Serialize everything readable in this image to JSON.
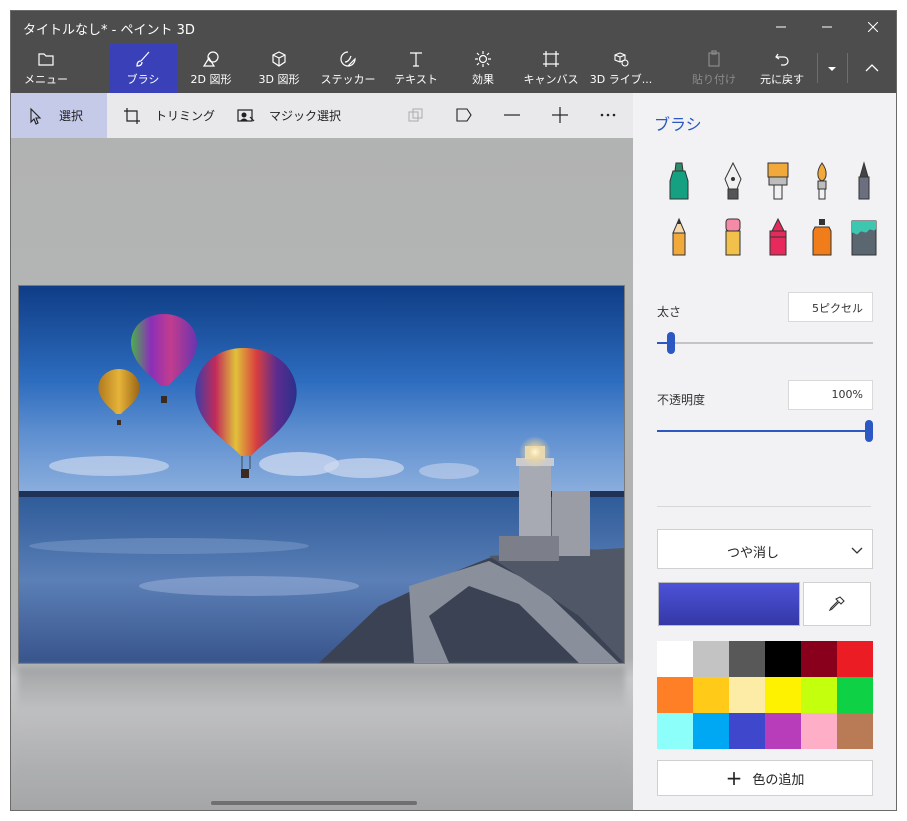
{
  "window": {
    "title": "タイトルなし* - ペイント 3D"
  },
  "titlebar_buttons": [
    "minimize-icon",
    "maximize-icon",
    "close-icon"
  ],
  "toolbar": {
    "menu": "メニュー",
    "brush": "ブラシ",
    "shapes2d": "2D 図形",
    "shapes3d": "3D 図形",
    "stickers": "ステッカー",
    "text": "テキスト",
    "effects": "効果",
    "canvas": "キャンバス",
    "library3d": "3D ライブ...",
    "paste": "貼り付け",
    "undo": "元に戻す"
  },
  "subtoolbar": {
    "select": "選択",
    "crop": "トリミング",
    "magic_select": "マジック選択"
  },
  "panel": {
    "title": "ブラシ",
    "brushes": [
      "marker",
      "calligraphy-pen",
      "oil-brush",
      "watercolor",
      "pixel-pen",
      "pencil",
      "eraser",
      "crayon",
      "spray-can",
      "fill"
    ],
    "thickness_label": "太さ",
    "thickness_value": "5ピクセル",
    "thickness_fraction": 0.05,
    "opacity_label": "不透明度",
    "opacity_value": "100%",
    "opacity_fraction": 1.0,
    "finish_value": "つや消し",
    "current_color": "#4247c8",
    "add_color_label": "色の追加",
    "palette": [
      "#ffffff",
      "#c3c3c3",
      "#585858",
      "#000000",
      "#88001b",
      "#ec1c24",
      "#ff7f27",
      "#ffca18",
      "#fdeca6",
      "#fff200",
      "#c4ff0e",
      "#0ed145",
      "#8cfffb",
      "#00a8f3",
      "#3f48cc",
      "#b83dba",
      "#ffaec8",
      "#b97a56"
    ]
  },
  "accent_color": "#2b58c2"
}
